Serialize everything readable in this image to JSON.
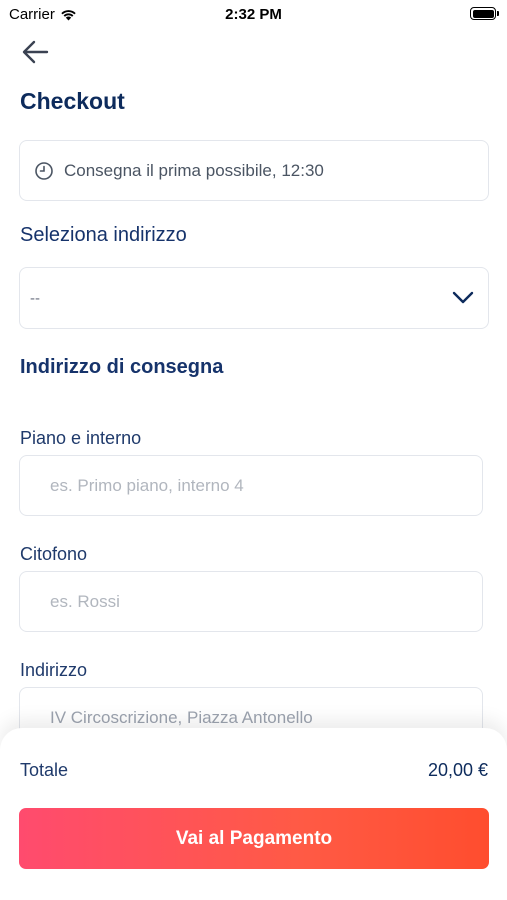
{
  "status_bar": {
    "carrier": "Carrier",
    "time": "2:32 PM"
  },
  "header": {
    "title": "Checkout"
  },
  "delivery_time": {
    "label": "Consegna il prima possibile, 12:30"
  },
  "address_select": {
    "heading": "Seleziona indirizzo",
    "value": "--"
  },
  "delivery_address": {
    "heading": "Indirizzo di consegna",
    "fields": [
      {
        "label": "Piano e interno",
        "placeholder": "es. Primo piano, interno 4",
        "value": ""
      },
      {
        "label": "Citofono",
        "placeholder": "es. Rossi",
        "value": ""
      },
      {
        "label": "Indirizzo",
        "placeholder": "",
        "value": "IV Circoscrizione, Piazza Antonello"
      }
    ]
  },
  "summary": {
    "total_label": "Totale",
    "total_value": "20,00 €"
  },
  "actions": {
    "pay_label": "Vai al Pagamento"
  },
  "colors": {
    "primary_text": "#0d2b5c",
    "button_gradient_start": "#ff4b6e",
    "button_gradient_end": "#ff4d2e"
  }
}
